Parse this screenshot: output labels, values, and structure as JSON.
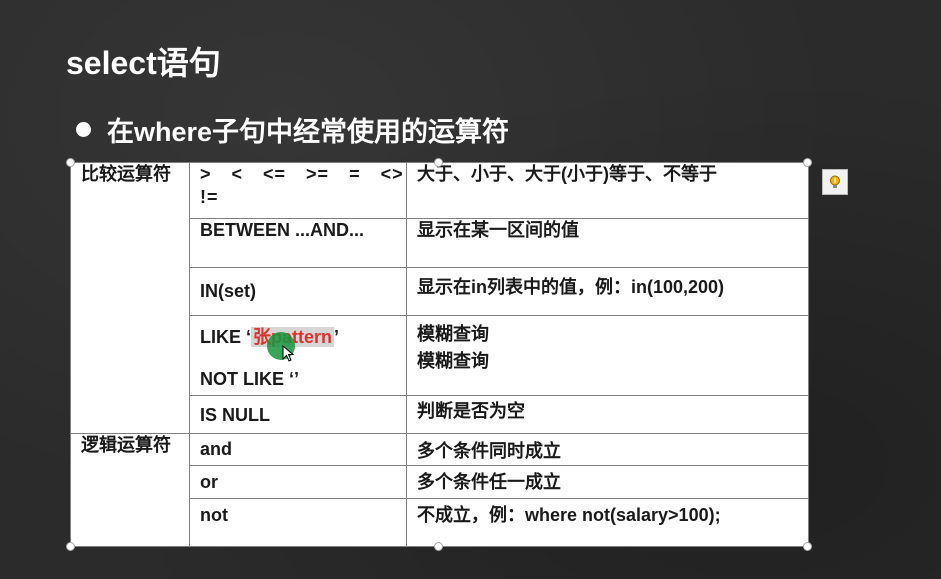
{
  "slide": {
    "title": "select语句",
    "bullet": "在where子句中经常使用的运算符"
  },
  "groups": {
    "compare": "比较运算符",
    "logic": "逻辑运算符"
  },
  "rows": {
    "cmp_ops": "> < <= >= = <> !=",
    "cmp_desc": "大于、小于、大于(小于)等于、不等于",
    "between_op": "BETWEEN ...AND...",
    "between_desc": "显示在某一区间的值",
    "in_op": "IN(set)",
    "in_desc": "显示在in列表中的值，例：in(100,200)",
    "like_op_prefix": "LIKE ‘",
    "like_op_highlight": "张pattern",
    "like_op_suffix": "’",
    "notlike_op": "NOT LIKE ‘’",
    "like_desc": "模糊查询",
    "notlike_desc": "模糊查询",
    "isnull_op": "IS NULL",
    "isnull_desc": "判断是否为空",
    "and_op": "and",
    "and_desc": "多个条件同时成立",
    "or_op": "or",
    "or_desc": "多个条件任一成立",
    "not_op": "not",
    "not_desc": "不成立，例：where not(salary>100);"
  },
  "icons": {
    "lightbulb": "lightbulb-icon",
    "cursor": "pointer-cursor-icon"
  },
  "colors": {
    "operator_red": "#e0302a",
    "background": "#2b2b2b"
  }
}
